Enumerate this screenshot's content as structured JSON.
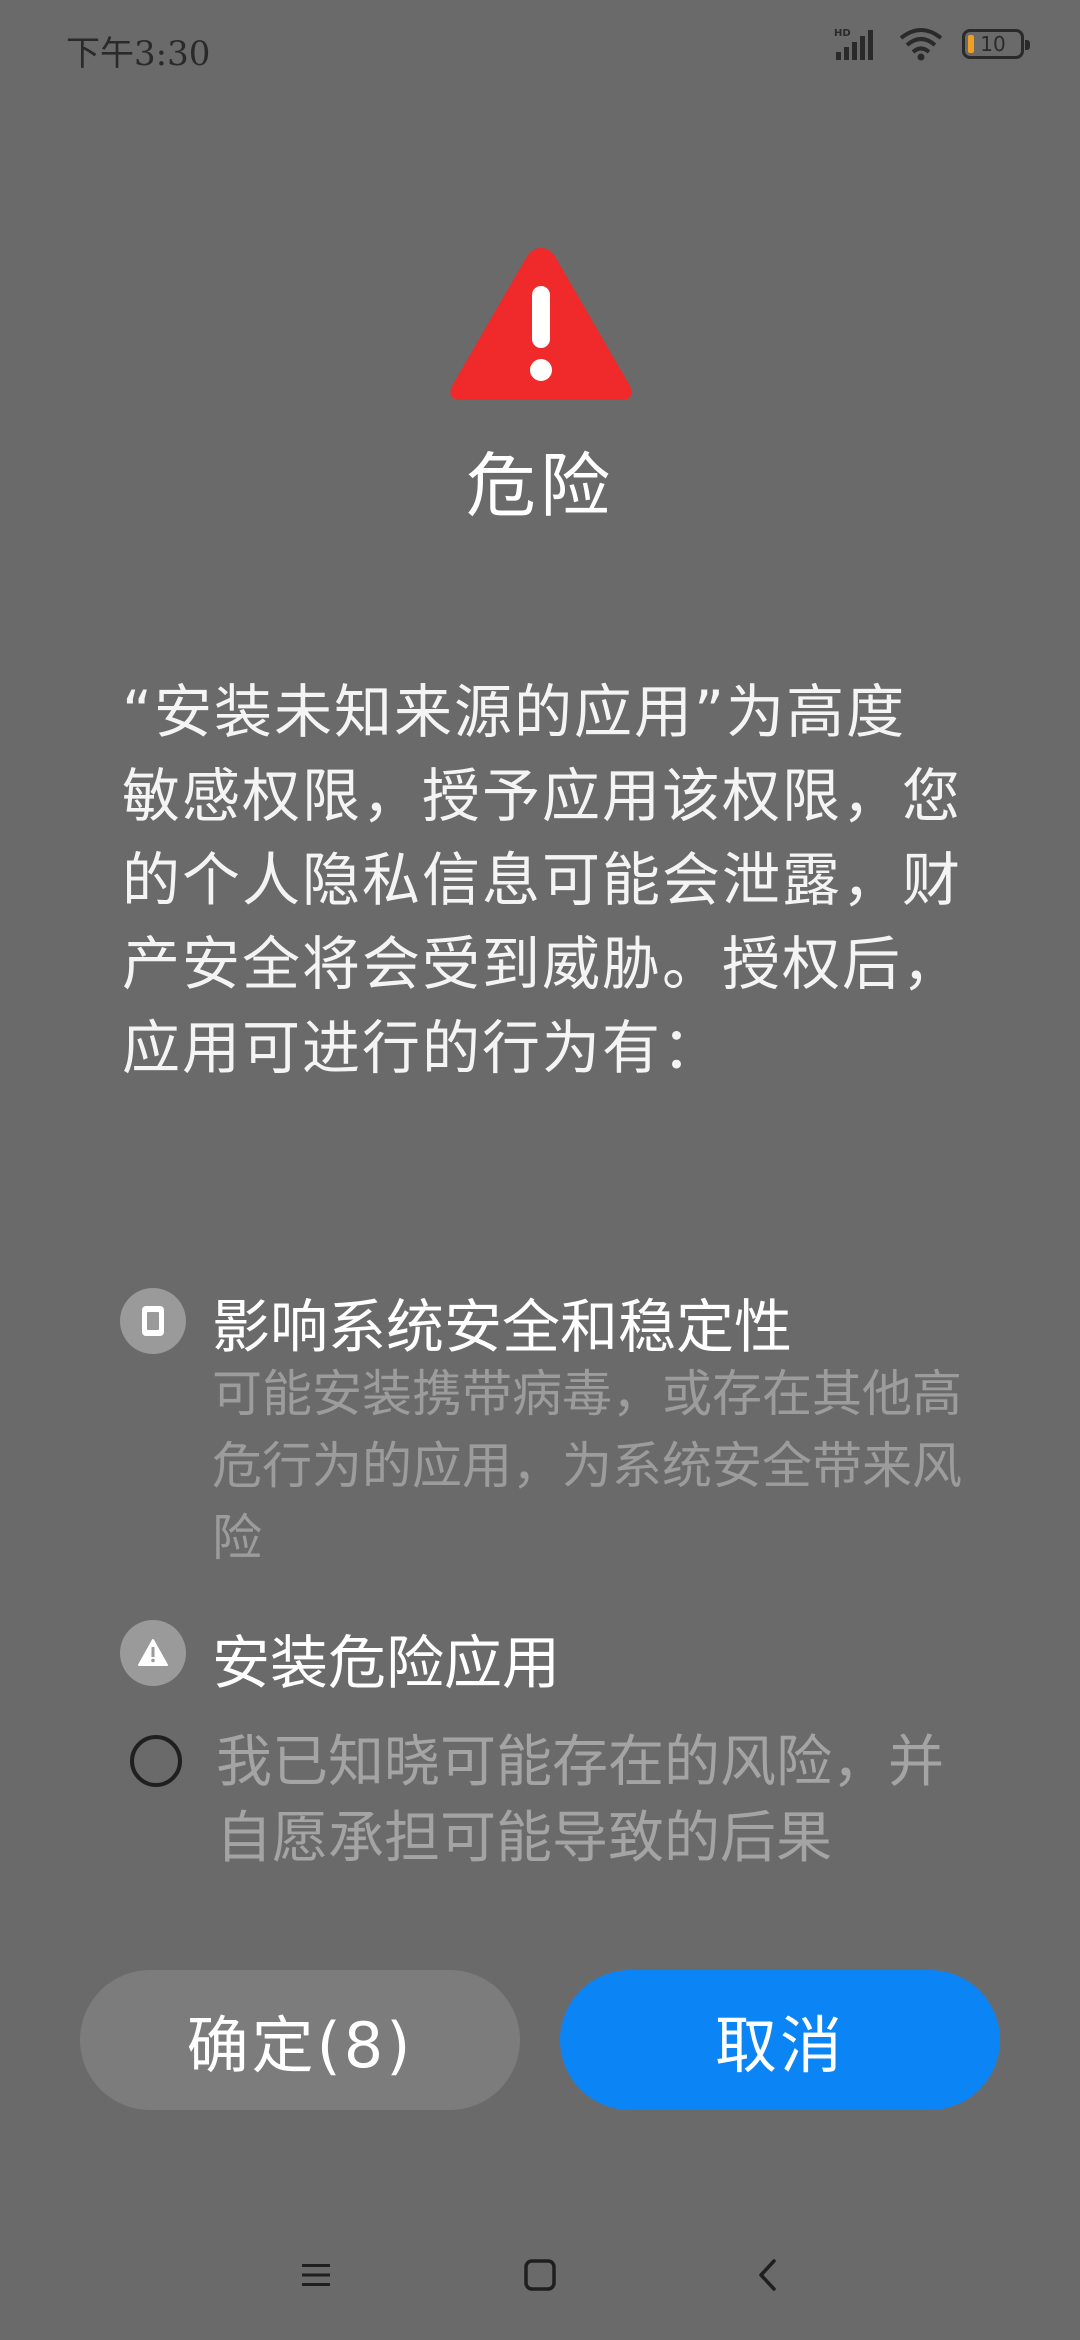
{
  "status_bar": {
    "time": "下午3:30",
    "battery_level": "10",
    "icons": [
      "hd-signal-icon",
      "wifi-icon",
      "battery-icon"
    ]
  },
  "dialog": {
    "icon": "warning-triangle-icon",
    "title": "危险",
    "description": "“安装未知来源的应用”为高度敏感权限，授予应用该权限，您的个人隐私信息可能会泄露，财产安全将会受到威胁。授权后，应用可进行的行为有：",
    "items": [
      {
        "icon": "phone-icon",
        "title": "影响系统安全和稳定性",
        "desc": "可能安装携带病毒，或存在其他高危行为的应用，为系统安全带来风险"
      },
      {
        "icon": "warning-icon",
        "title": "安装危险应用",
        "desc": ""
      }
    ],
    "acknowledge_label": "我已知晓可能存在的风险，并自愿承担可能导致的后果",
    "confirm_label": "确定(8)",
    "cancel_label": "取消"
  },
  "colors": {
    "background": "#6a6a6a",
    "danger_red": "#f02a2a",
    "primary_blue": "#0b84f6",
    "confirm_gray": "#7c7c7c"
  },
  "nav_bar": {
    "icons": [
      "menu-icon",
      "home-icon",
      "back-icon"
    ]
  }
}
